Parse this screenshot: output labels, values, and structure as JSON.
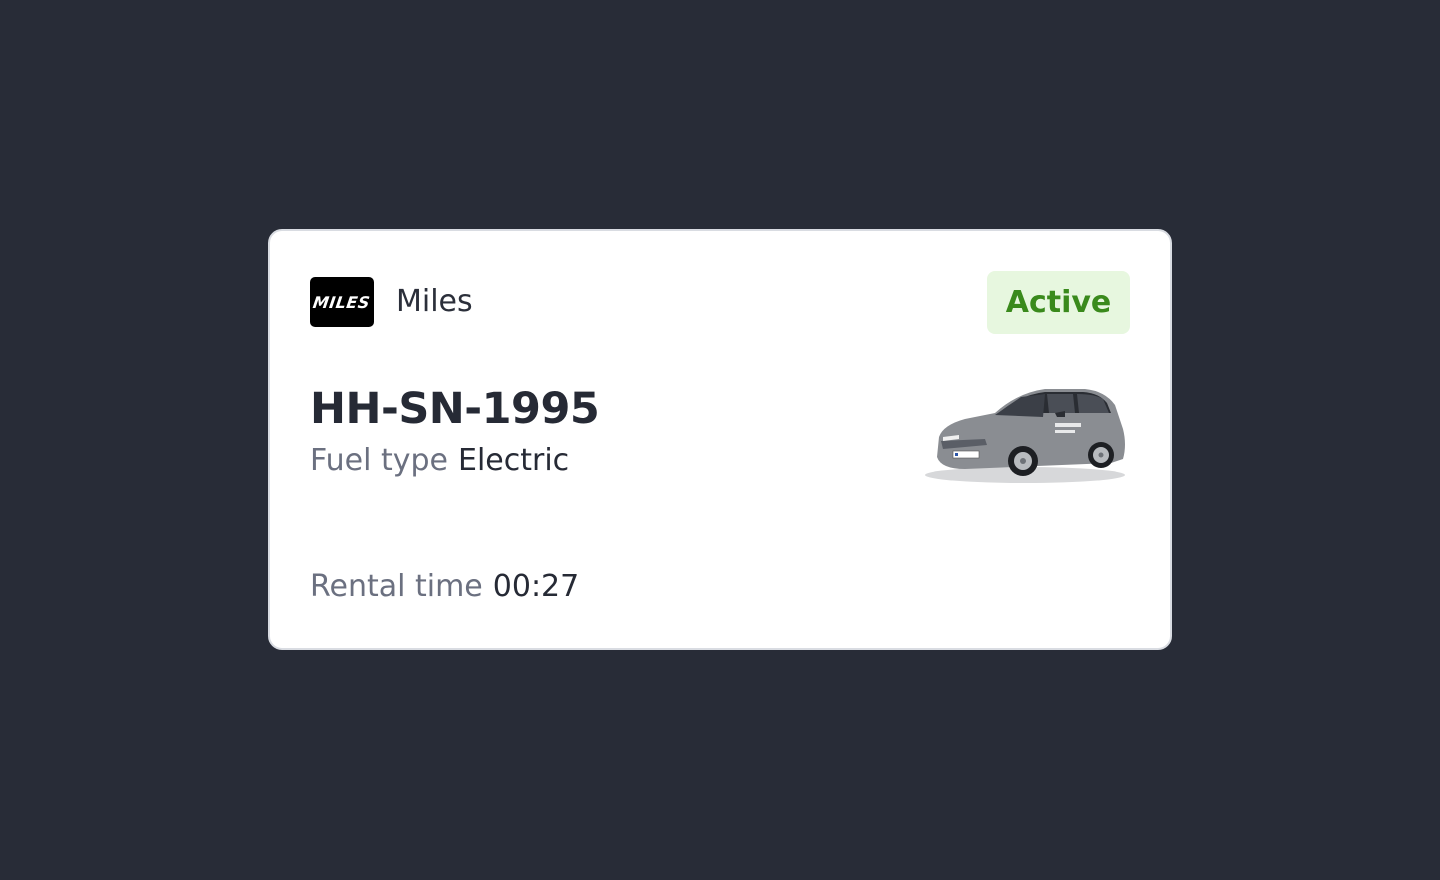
{
  "card": {
    "provider": {
      "logo_text": "MILES",
      "name": "Miles"
    },
    "status": "Active",
    "plate": "HH-SN-1995",
    "fuel": {
      "label": "Fuel type",
      "value": "Electric"
    },
    "rental": {
      "label": "Rental time",
      "value": "00:27"
    },
    "car_image": "car-image",
    "colors": {
      "background": "#282c37",
      "badge_bg": "#e7f7df",
      "badge_text": "#3a8a1c",
      "car_body": "#8a8d92"
    }
  }
}
